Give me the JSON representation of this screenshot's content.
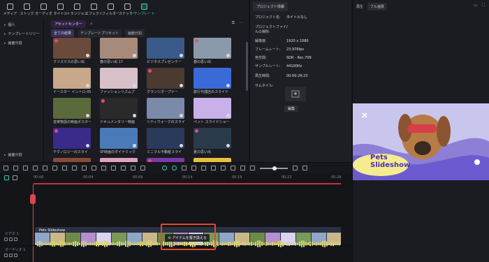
{
  "toolbar": {
    "items": [
      {
        "label": "メディア",
        "icon": "media-icon"
      },
      {
        "label": "ストック",
        "icon": "stock-icon"
      },
      {
        "label": "オーディオ",
        "icon": "audio-icon"
      },
      {
        "label": "タイトル",
        "icon": "title-icon"
      },
      {
        "label": "トランジョン",
        "icon": "transition-icon"
      },
      {
        "label": "エフェクト",
        "icon": "effect-icon"
      },
      {
        "label": "フィルター",
        "icon": "filter-icon"
      },
      {
        "label": "ステッカー",
        "icon": "sticker-icon"
      },
      {
        "label": "テンプレート",
        "icon": "template-icon"
      }
    ]
  },
  "categories": {
    "items": [
      "個人",
      "テンプレートリリー",
      "画面分割"
    ],
    "bottom": "画面分割"
  },
  "browser": {
    "tabs": [
      "アセットセンター"
    ],
    "filters": [
      "全ての結果",
      "テンプレートプリセット",
      "画面分割"
    ],
    "tiles": [
      {
        "caption": "クリスマスの思い出",
        "color": "#6a4a3a"
      },
      {
        "caption": "春の思い出 17",
        "color": "#a88a7a"
      },
      {
        "caption": "ビジネスプレゼンテー",
        "color": "#3a5a8a"
      },
      {
        "caption": "春の思い出",
        "color": "#8a9aaa"
      },
      {
        "caption": "イースター イントロ 05",
        "color": "#c8a88a"
      },
      {
        "caption": "ファッションリズムプ",
        "color": "#d8c0c8"
      },
      {
        "caption": "グランジオープナー",
        "color": "#4a3a30"
      },
      {
        "caption": "旅行代理店のスライド",
        "color": "#3a6ad8"
      },
      {
        "caption": "音楽物語の映画ポスター",
        "color": "#5a6a3a"
      },
      {
        "caption": "ドキュメンタリー映画",
        "color": "#2a2a2a"
      },
      {
        "caption": "シティウォークのスライ",
        "color": "#7a8aa8"
      },
      {
        "caption": "ペット スライドショー",
        "color": "#c8b0e8"
      },
      {
        "caption": "テクノロジーのスライ",
        "color": "#3a2a8a"
      },
      {
        "caption": "SF映画のダイナミック",
        "color": "#4a7ab8"
      },
      {
        "caption": "ミニマル不動産スライ",
        "color": "#2a3a5a"
      },
      {
        "caption": "夏の思い出",
        "color": "#2a3a4a"
      },
      {
        "caption": "",
        "color": "#8a4a3a"
      },
      {
        "caption": "",
        "color": "#e0a0c0"
      },
      {
        "caption": "",
        "color": "#7a3aa8"
      },
      {
        "caption": "",
        "color": "#e8c040"
      }
    ]
  },
  "info": {
    "tab": "プロジェクト情報",
    "rows": [
      {
        "k": "プロジェクト名:",
        "v": "タイトルなし"
      },
      {
        "k": "プロジェクトファイルの場所:",
        "v": "/"
      },
      {
        "k": "解像度:",
        "v": "1920 x 1080"
      },
      {
        "k": "フレームレート:",
        "v": "23.976fps"
      },
      {
        "k": "色空間:",
        "v": "SDR - Rec.709"
      },
      {
        "k": "サンプルレート:",
        "v": "44100Hz"
      },
      {
        "k": "再生時間:",
        "v": "00:00:29:23"
      },
      {
        "k": "サムネイル:",
        "v": ""
      }
    ],
    "edit": "編集"
  },
  "preview": {
    "play_label": "再生",
    "quality": "フル画質",
    "title_line1": "Pets",
    "title_line2": "Slideshow"
  },
  "timeline": {
    "ticks": [
      "00:00",
      "00:04",
      "00:09",
      "00:14",
      "00:19",
      "00:23",
      "00:28"
    ],
    "video_track": "ビデオ 1",
    "audio_track": "オーディオ 1",
    "clip_label": "Pets Slideshow",
    "replace_label": "アイテムを置き換える"
  }
}
